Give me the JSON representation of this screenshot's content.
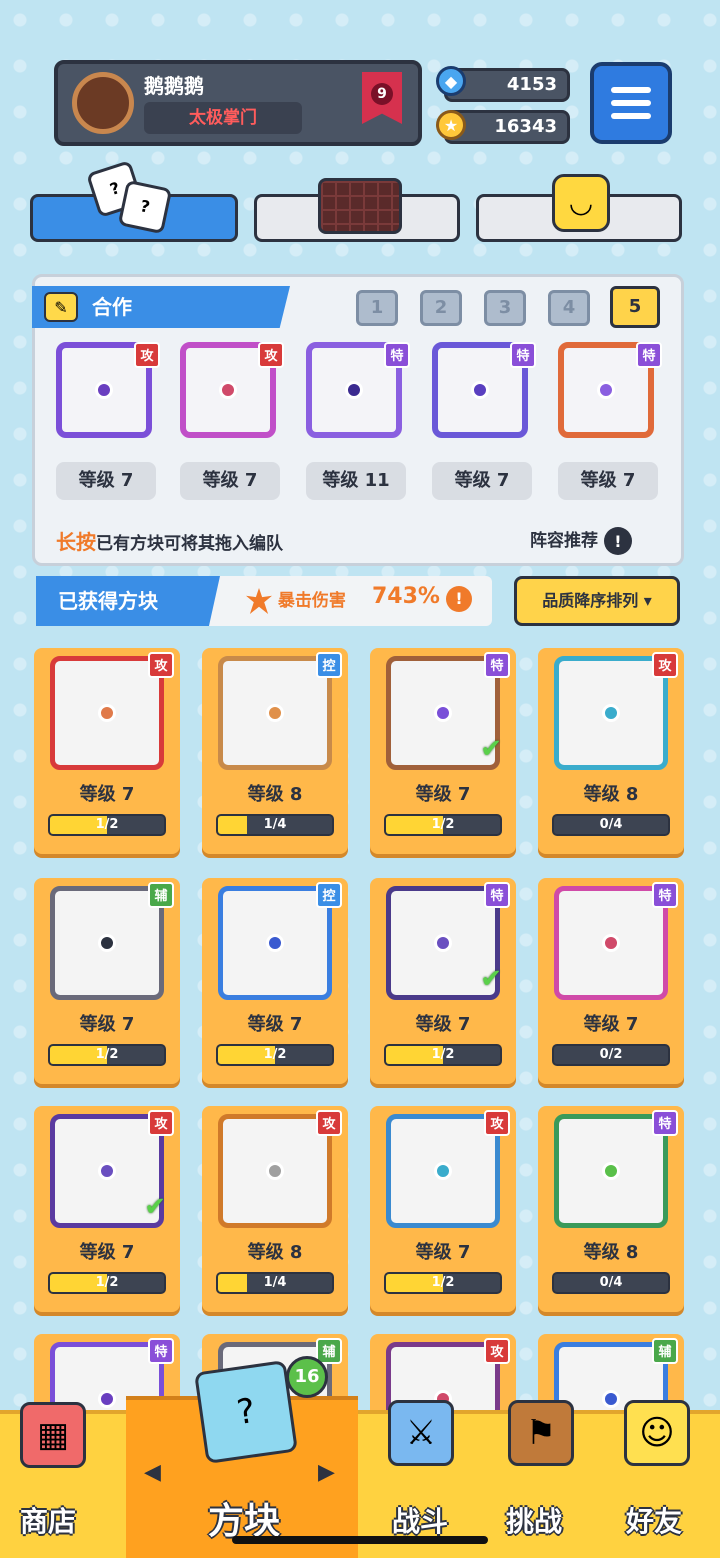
{
  "profile": {
    "name": "鹅鹅鹅",
    "title": "太极掌门",
    "rank": "9"
  },
  "currency": {
    "gems": "4153",
    "coins": "16343"
  },
  "team": {
    "section_title": "合作",
    "pages": [
      "1",
      "2",
      "3",
      "4",
      "5"
    ],
    "active_page": 4,
    "slots": [
      {
        "tag": "攻",
        "level": "等级 7",
        "color": "#7b4fd8",
        "dot": "#6a3fc0"
      },
      {
        "tag": "攻",
        "level": "等级 7",
        "color": "#c04fc8",
        "dot": "#d04a6a"
      },
      {
        "tag": "特",
        "level": "等级 11",
        "color": "#8a5fe0",
        "dot": "#3b2a90"
      },
      {
        "tag": "特",
        "level": "等级 7",
        "color": "#6a58d8",
        "dot": "#5a3fc0"
      },
      {
        "tag": "特",
        "level": "等级 7",
        "color": "#e06a3a",
        "dot": "#8a5fe0"
      }
    ],
    "hint_bold": "长按",
    "hint": "已有方块可将其拖入编队",
    "recommend": "阵容推荐"
  },
  "owned": {
    "title": "已获得方块",
    "crit_label": "暴击伤害",
    "crit_value": "743%",
    "sort": "品质降序排列 ▾"
  },
  "cards": [
    {
      "tag": "攻",
      "tagc": "#d83a3a",
      "level": "等级 7",
      "prog": "1/2",
      "fill": 0.5,
      "border": "#d83a3a",
      "dot": "#e07a4a",
      "check": false
    },
    {
      "tag": "控",
      "tagc": "#3a8ee6",
      "level": "等级 8",
      "prog": "1/4",
      "fill": 0.25,
      "border": "#c88a4a",
      "dot": "#e0904a",
      "check": false
    },
    {
      "tag": "特",
      "tagc": "#8a4fd8",
      "level": "等级 7",
      "prog": "1/2",
      "fill": 0.5,
      "border": "#a0603a",
      "dot": "#7a4fd8",
      "check": true
    },
    {
      "tag": "攻",
      "tagc": "#d83a3a",
      "level": "等级 8",
      "prog": "0/4",
      "fill": 0,
      "border": "#3aaccc",
      "dot": "#3aaccc",
      "check": false
    },
    {
      "tag": "辅",
      "tagc": "#4aa84a",
      "level": "等级 7",
      "prog": "1/2",
      "fill": 0.5,
      "border": "#6a6a7a",
      "dot": "#2c3240",
      "check": false
    },
    {
      "tag": "控",
      "tagc": "#3a8ee6",
      "level": "等级 7",
      "prog": "1/2",
      "fill": 0.5,
      "border": "#3a7ee0",
      "dot": "#3a5ad0",
      "check": false
    },
    {
      "tag": "特",
      "tagc": "#8a4fd8",
      "level": "等级 7",
      "prog": "1/2",
      "fill": 0.5,
      "border": "#4a3a8a",
      "dot": "#6a4fc0",
      "check": true
    },
    {
      "tag": "特",
      "tagc": "#8a4fd8",
      "level": "等级 7",
      "prog": "0/2",
      "fill": 0,
      "border": "#d04aa8",
      "dot": "#d04a6a",
      "check": false
    },
    {
      "tag": "攻",
      "tagc": "#d83a3a",
      "level": "等级 7",
      "prog": "1/2",
      "fill": 0.5,
      "border": "#5a3aa0",
      "dot": "#6a4fc0",
      "check": true
    },
    {
      "tag": "攻",
      "tagc": "#d83a3a",
      "level": "等级 8",
      "prog": "1/4",
      "fill": 0.25,
      "border": "#d07a2a",
      "dot": "#a0a0a0",
      "check": false
    },
    {
      "tag": "攻",
      "tagc": "#d83a3a",
      "level": "等级 7",
      "prog": "1/2",
      "fill": 0.5,
      "border": "#3a8ad0",
      "dot": "#3aaccc",
      "check": false
    },
    {
      "tag": "特",
      "tagc": "#8a4fd8",
      "level": "等级 8",
      "prog": "0/4",
      "fill": 0,
      "border": "#3a9a5a",
      "dot": "#5ac04a",
      "check": false
    },
    {
      "tag": "特",
      "tagc": "#8a4fd8",
      "level": "",
      "prog": "",
      "fill": 0,
      "border": "#7a4fd8",
      "dot": "#6a3fc0",
      "check": false
    },
    {
      "tag": "辅",
      "tagc": "#4aa84a",
      "level": "",
      "prog": "",
      "fill": 0,
      "border": "#6a6a7a",
      "dot": "#6a6a7a",
      "check": false
    },
    {
      "tag": "攻",
      "tagc": "#d83a3a",
      "level": "",
      "prog": "",
      "fill": 0,
      "border": "#7a3a8a",
      "dot": "#d04a6a",
      "check": false
    },
    {
      "tag": "辅",
      "tagc": "#4aa84a",
      "level": "",
      "prog": "",
      "fill": 0,
      "border": "#3a7ee0",
      "dot": "#3a5ad0",
      "check": false
    }
  ],
  "nav": {
    "shop": "商店",
    "blocks": "方块",
    "battle": "战斗",
    "challenge": "挑战",
    "friends": "好友",
    "badge": "16",
    "left_arrow": "◀",
    "right_arrow": "▶"
  }
}
